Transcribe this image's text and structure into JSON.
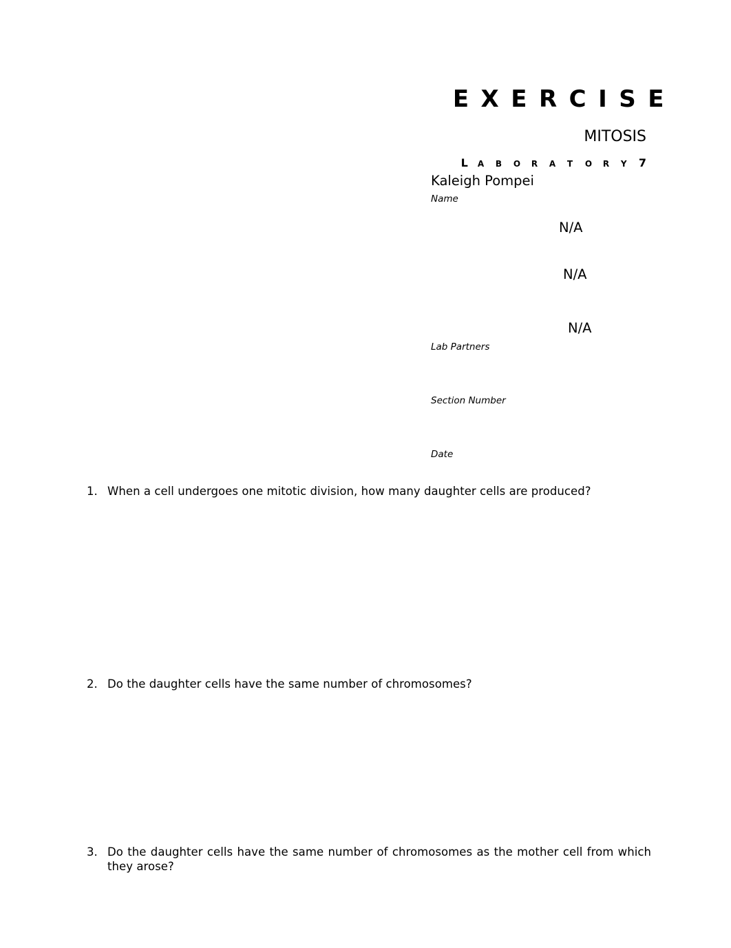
{
  "header": {
    "exercise_label": "EXERCISE",
    "topic": "MITOSIS",
    "lab_label_parts": [
      {
        "text": "L",
        "style": "cap"
      },
      {
        "text": "ABORATORY",
        "style": "smallcaps"
      },
      {
        "text": "7",
        "style": "cap"
      }
    ],
    "lab_label": "Laboratory 7"
  },
  "student": {
    "name_value": "Kaleigh Pompei",
    "name_label": "Name"
  },
  "lab_partners": {
    "values": [
      "N/A",
      "N/A",
      "N/A"
    ],
    "label": "Lab Partners"
  },
  "section": {
    "label": "Section Number",
    "value": ""
  },
  "date": {
    "label": "Date",
    "value": ""
  },
  "questions": [
    {
      "number": "1.",
      "text": "When a cell undergoes one mitotic division, how many daughter cells are produced?"
    },
    {
      "number": "2.",
      "text": "Do the daughter cells have the same number of chromosomes?"
    },
    {
      "number": "3.",
      "text": "Do the daughter cells have the same number of chromosomes as the mother cell from which they arose?"
    }
  ]
}
